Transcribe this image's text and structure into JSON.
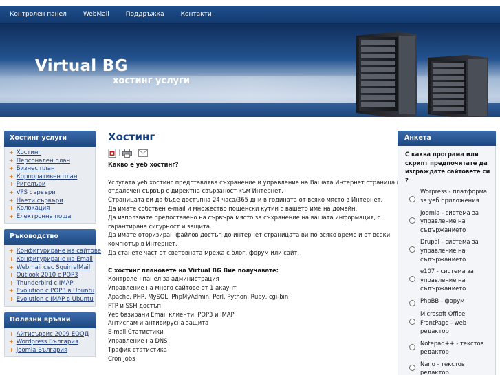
{
  "topnav": [
    "Контролен панел",
    "WebMail",
    "Поддръжка",
    "Контакти"
  ],
  "header": {
    "title": "Virtual BG",
    "subtitle": "хостинг услуги"
  },
  "left": [
    {
      "title": "Хостинг услуги",
      "items": [
        "Хостинг",
        "Персонален план",
        "Бизнес план",
        "Корпоративен план",
        "Ригелъри",
        "VPS сървъри",
        "Наети сървъри",
        "Колокация",
        "Електронна поща"
      ]
    },
    {
      "title": "Ръководство",
      "items": [
        "Конфигуриране на сайтове",
        "Конфигуриране на Email",
        "Webmail със SquirrelMail",
        "Outlook 2010 с POP3",
        "Thunderbird с IMAP",
        "Evolution с POP3 в Ubuntu",
        "Evolution с IMAP в Ubuntu"
      ]
    },
    {
      "title": "Полезни връзки",
      "items": [
        "Айтисървис 2009 ЕООД",
        "Wordpress България",
        "Joomla България"
      ]
    }
  ],
  "main": {
    "title": "Хостинг",
    "question": "Какво е уеб хостинг?",
    "para": [
      "Услугата уеб хостинг представлява съхранение и управление на Вашата Интернет страница на",
      "отдалечен сървър с директна свързаност към Интернет.",
      "Страницата ви да бъде достъпна 24 часа/365 дни в годината от всяко място в Интернет.",
      "Да имате собствен e-mail и множество пощенски кутии с вашето име на домейн.",
      "Да използвате предоставено на сървъра място за съхранение на вашата информация, с",
      "гарантирана сигурност и защита.",
      "Да имате оторизиран файлов достъп до интернет страницата ви по всяко време и от всеки",
      "компютър в Интернет.",
      "Да станете част от световната мрежа с блог, форум или сайт."
    ],
    "features_title": "С хостинг плановете на Virtual BG Вие получавате:",
    "features": [
      "Контролен панел за администрация",
      "Управление на много сайтове от 1 акаунт",
      "Apache, PHP, MySQL, PhpMyAdmin, Perl, Python, Ruby, cgi-bin",
      "FTP и SSH достъп",
      "Уеб базирани Email клиенти, POP3 и IMAP",
      "Антиспам и антивирусна защита",
      "E-mail Статистики",
      "Управление на DNS",
      "Трафик статистика",
      "Cron Jobs"
    ]
  },
  "poll": {
    "title": "Анкета",
    "question": "С каква програма или скрипт предпочитате да изграждате сайтовете си ?",
    "options": [
      "Worpress - платформа за уеб приложения",
      "Joomla - система за управление на съдържанието",
      "Drupal - система за управление на съдържанието",
      "e107 - система за управление на съдържанието",
      "PhpBB - форум",
      "Microsoft Office FrontPage - web редактор",
      "Notepad++ - текстов редактор",
      "Nano - текстов редактор"
    ]
  },
  "colors": {
    "nav": "#1a4680",
    "heading": "#16407e",
    "bullet": "#d06a10",
    "link": "#1f3f80"
  }
}
